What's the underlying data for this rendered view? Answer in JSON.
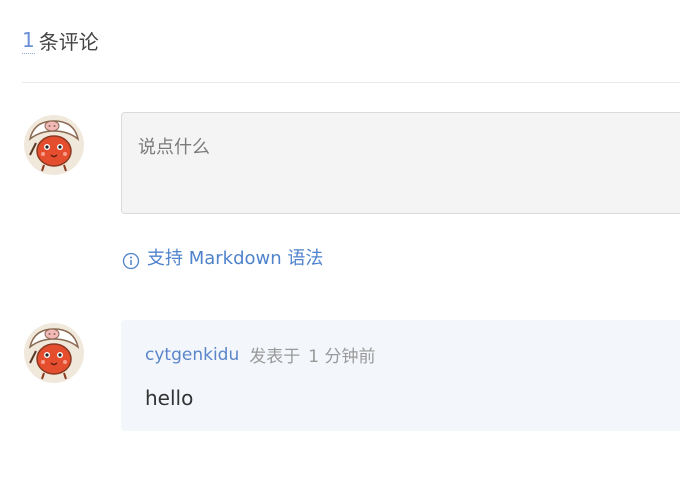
{
  "comments_header": {
    "count": "1",
    "label": "条评论"
  },
  "editor": {
    "placeholder": "说点什么"
  },
  "markdown_tip": {
    "label": "支持 Markdown 语法",
    "icon": "info-icon"
  },
  "comments": [
    {
      "author": "cytgenkidu",
      "posted_prefix": "发表于",
      "time": "1 分钟前",
      "text": "hello"
    }
  ],
  "colors": {
    "accent": "#5b85c9",
    "card_bg": "#f3f7fc",
    "input_bg": "#f4f4f4"
  }
}
